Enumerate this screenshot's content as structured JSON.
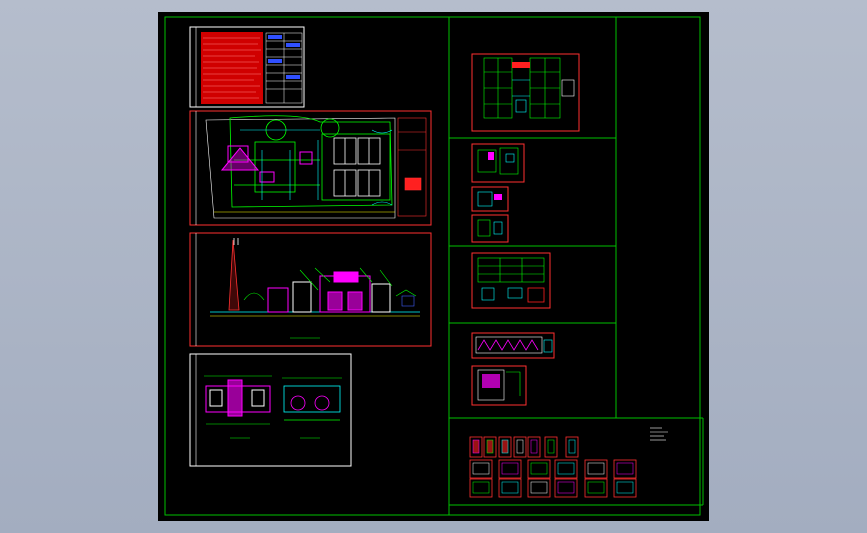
{
  "drawing": {
    "background_color": "#000000",
    "viewport_color": "#aeb6c7",
    "frame_color": "#00c000",
    "sheet_border_color": "#ff2020",
    "line_colors": {
      "green": "#00ff00",
      "cyan": "#00ffff",
      "magenta": "#ff00ff",
      "red": "#ff0000",
      "yellow": "#ffff00",
      "white": "#ffffff",
      "blue": "#4060ff"
    },
    "sheets": [
      {
        "id": "design-notes-sheet",
        "kind": "notes-table"
      },
      {
        "id": "site-plan-sheet",
        "kind": "plan"
      },
      {
        "id": "elevation-sheet",
        "kind": "elevation"
      },
      {
        "id": "section-details-sheet",
        "kind": "details"
      },
      {
        "id": "schematic-sheet-1",
        "kind": "schematic"
      },
      {
        "id": "detail-sheet-2a",
        "kind": "detail"
      },
      {
        "id": "detail-sheet-2b",
        "kind": "detail"
      },
      {
        "id": "detail-sheet-2c",
        "kind": "detail"
      },
      {
        "id": "schematic-sheet-3",
        "kind": "schematic"
      },
      {
        "id": "detail-sheet-4a",
        "kind": "detail"
      },
      {
        "id": "detail-sheet-4b",
        "kind": "detail"
      },
      {
        "id": "thumbnail-grid-sheet",
        "kind": "thumbnails"
      }
    ]
  }
}
